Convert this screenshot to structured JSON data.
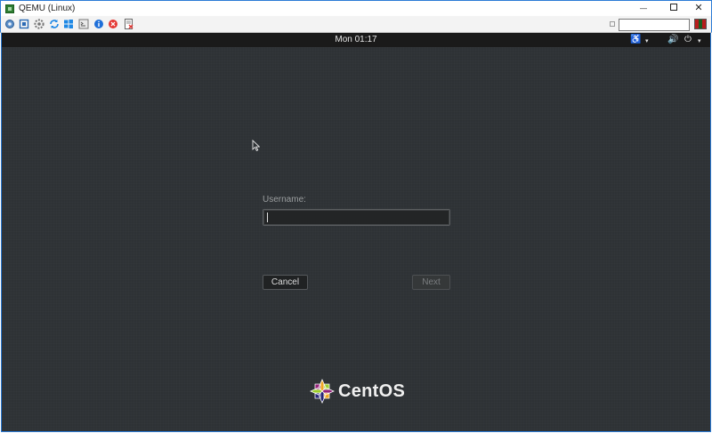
{
  "window": {
    "title": "QEMU (Linux)",
    "controls": {
      "minimize": "—",
      "close": "✕"
    }
  },
  "toolbar": {
    "icons": [
      "settings-icon",
      "fullscreen-icon",
      "gear-icon",
      "refresh-icon",
      "windows-icon",
      "console-icon",
      "info-icon",
      "stop-icon",
      "remove-device-icon"
    ],
    "text_field_value": ""
  },
  "topbar": {
    "clock": "Mon 01:17",
    "accessibility": "♿",
    "caret": "▾",
    "volume": "🔊",
    "power": "⏻"
  },
  "login": {
    "username_label": "Username:",
    "username_value": "",
    "cancel_label": "Cancel",
    "next_label": "Next"
  },
  "brand": {
    "name": "CentOS"
  },
  "colors": {
    "background": "#2e3235",
    "topbar": "#1a1a1a",
    "window_border": "#2b7bd6",
    "logo_yellow": "#efa724",
    "logo_green": "#9ccd2a",
    "logo_blue": "#262577",
    "logo_purple": "#932279"
  }
}
